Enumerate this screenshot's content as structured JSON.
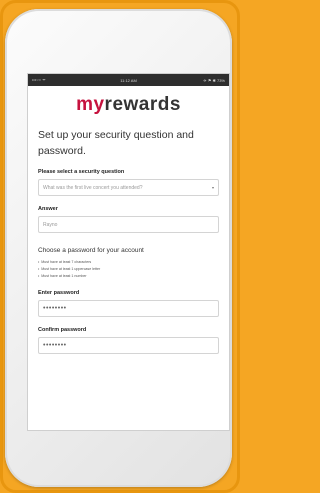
{
  "status_bar": {
    "carrier": "•••○○ ᯤ",
    "time": "11:12 AM",
    "battery": "✈ ⚑ ✱ 73%"
  },
  "logo": {
    "my": "my",
    "rewards": "rewards"
  },
  "heading": "Set up your security question and password.",
  "security": {
    "label": "Please select a security question",
    "selected": "What was the first live concert you attended?",
    "arrow": "▾"
  },
  "answer": {
    "label": "Answer",
    "value": "Rayno"
  },
  "password_section": {
    "title": "Choose a password for your account",
    "rules": [
      "Must have at least 7 characters",
      "Must have at least 1 uppercase letter",
      "Must have at least 1 number"
    ]
  },
  "enter_password": {
    "label": "Enter password",
    "value": "••••••••"
  },
  "confirm_password": {
    "label": "Confirm password",
    "value": "••••••••"
  },
  "colors": {
    "background": "#f5a623",
    "brand_red": "#c6123e"
  }
}
